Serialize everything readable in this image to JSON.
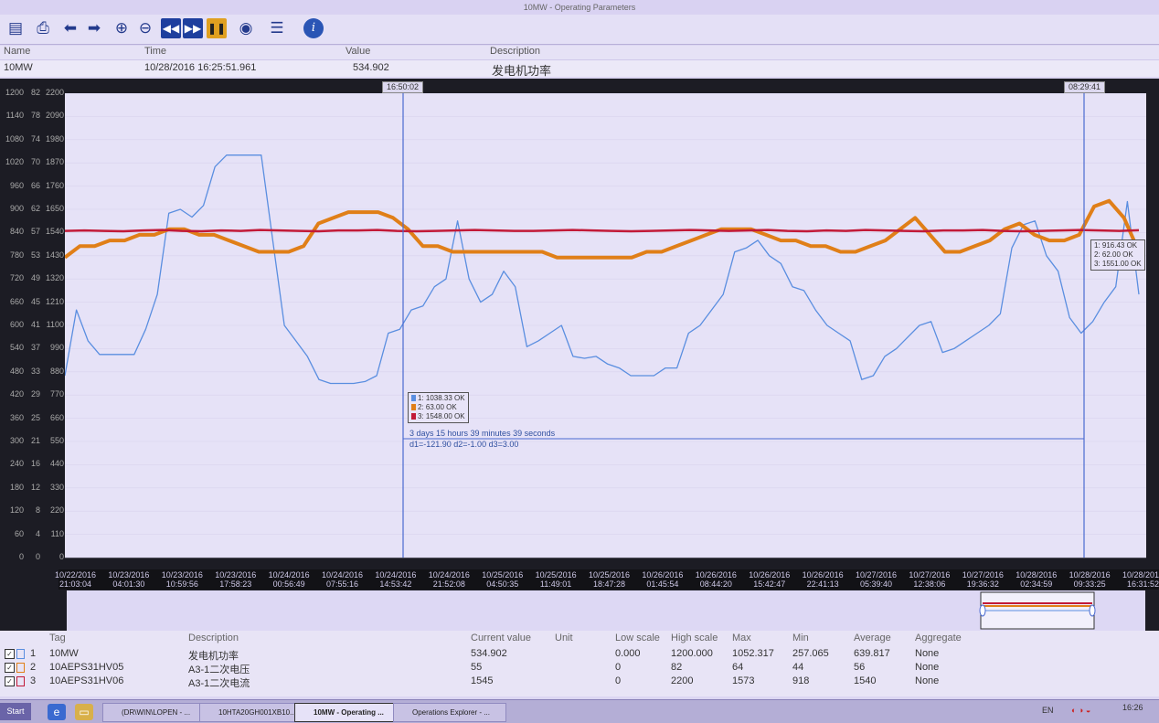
{
  "window": {
    "title": "10MW - Operating Parameters"
  },
  "toolbar": {
    "buttons": [
      {
        "name": "open-icon",
        "glyph": "▤"
      },
      {
        "name": "print-icon",
        "glyph": "⎙"
      },
      {
        "name": "back-arrow-icon",
        "glyph": "⬅"
      },
      {
        "name": "forward-arrow-icon",
        "glyph": "➡"
      },
      {
        "name": "zoom-in-icon",
        "glyph": "⊕"
      },
      {
        "name": "zoom-out-icon",
        "glyph": "⊖"
      },
      {
        "name": "rewind-icon",
        "glyph": "◀◀"
      },
      {
        "name": "fast-forward-icon",
        "glyph": "▶▶"
      },
      {
        "name": "pause-icon",
        "glyph": "❚❚"
      },
      {
        "name": "eye-icon",
        "glyph": "◉"
      },
      {
        "name": "list-settings-icon",
        "glyph": "☰"
      },
      {
        "name": "help-icon",
        "glyph": "i"
      }
    ]
  },
  "info": {
    "headers": {
      "name": "Name",
      "time": "Time",
      "value": "Value",
      "description": "Description"
    },
    "row": {
      "name": "10MW",
      "time": "10/28/2016 16:25:51.961",
      "value": "534.902",
      "description": "发电机功率"
    }
  },
  "chart_data": {
    "type": "line",
    "axes": [
      {
        "series": "10MW",
        "ylim": [
          0,
          1200
        ],
        "ticks": [
          "1200",
          "1140",
          "1080",
          "1020",
          "960",
          "900",
          "840",
          "780",
          "720",
          "660",
          "600",
          "540",
          "480",
          "420",
          "360",
          "300",
          "240",
          "180",
          "120",
          "60",
          "0"
        ]
      },
      {
        "series": "10AEPS31HV05",
        "ylim": [
          0,
          82
        ],
        "ticks": [
          "82",
          "78",
          "74",
          "70",
          "66",
          "62",
          "57",
          "53",
          "49",
          "45",
          "41",
          "37",
          "33",
          "29",
          "25",
          "21",
          "16",
          "12",
          "8",
          "4",
          "0"
        ]
      },
      {
        "series": "10AEPS31HV06",
        "ylim": [
          0,
          2200
        ],
        "ticks": [
          "2200",
          "2090",
          "1980",
          "1870",
          "1760",
          "1650",
          "1540",
          "1430",
          "1320",
          "1210",
          "1100",
          "990",
          "880",
          "770",
          "660",
          "550",
          "440",
          "330",
          "220",
          "110",
          "0"
        ]
      }
    ],
    "x_ticks": [
      [
        "10/22/2016",
        "21:03:04"
      ],
      [
        "10/23/2016",
        "04:01:30"
      ],
      [
        "10/23/2016",
        "10:59:56"
      ],
      [
        "10/23/2016",
        "17:58:23"
      ],
      [
        "10/24/2016",
        "00:56:49"
      ],
      [
        "10/24/2016",
        "07:55:16"
      ],
      [
        "10/24/2016",
        "14:53:42"
      ],
      [
        "10/24/2016",
        "21:52:08"
      ],
      [
        "10/25/2016",
        "04:50:35"
      ],
      [
        "10/25/2016",
        "11:49:01"
      ],
      [
        "10/25/2016",
        "18:47:28"
      ],
      [
        "10/26/2016",
        "01:45:54"
      ],
      [
        "10/26/2016",
        "08:44:20"
      ],
      [
        "10/26/2016",
        "15:42:47"
      ],
      [
        "10/26/2016",
        "22:41:13"
      ],
      [
        "10/27/2016",
        "05:39:40"
      ],
      [
        "10/27/2016",
        "12:38:06"
      ],
      [
        "10/27/2016",
        "19:36:32"
      ],
      [
        "10/28/2016",
        "02:34:59"
      ],
      [
        "10/28/2016",
        "09:33:25"
      ],
      [
        "10/28/2016",
        "16:31:52"
      ]
    ],
    "series": [
      {
        "name": "10MW",
        "color": "#5a8ee0",
        "axis": 0,
        "values": [
          470,
          640,
          560,
          525,
          525,
          525,
          525,
          590,
          680,
          890,
          900,
          880,
          910,
          1010,
          1040,
          1040,
          1040,
          1040,
          820,
          600,
          560,
          520,
          460,
          450,
          450,
          450,
          455,
          470,
          580,
          590,
          640,
          650,
          700,
          720,
          870,
          720,
          660,
          680,
          740,
          700,
          545,
          560,
          580,
          600,
          520,
          515,
          520,
          500,
          490,
          470,
          470,
          470,
          490,
          490,
          580,
          600,
          640,
          680,
          790,
          800,
          820,
          780,
          760,
          700,
          690,
          640,
          600,
          580,
          560,
          460,
          470,
          520,
          540,
          570,
          600,
          610,
          530,
          540,
          560,
          580,
          600,
          630,
          800,
          860,
          870,
          780,
          740,
          620,
          580,
          610,
          660,
          700,
          920,
          680
        ]
      },
      {
        "name": "10AEPS31HV05",
        "color": "#e07f18",
        "axis": 1,
        "values": [
          53,
          55,
          55,
          56,
          56,
          57,
          57,
          58,
          58,
          57,
          57,
          56,
          55,
          54,
          54,
          54,
          55,
          59,
          60,
          61,
          61,
          61,
          60,
          58,
          55,
          55,
          54,
          54,
          54,
          54,
          54,
          54,
          54,
          53,
          53,
          53,
          53,
          53,
          53,
          54,
          54,
          55,
          56,
          57,
          58,
          58,
          58,
          57,
          56,
          56,
          55,
          55,
          54,
          54,
          55,
          56,
          58,
          60,
          57,
          54,
          54,
          55,
          56,
          58,
          59,
          57,
          56,
          56,
          57,
          62,
          63,
          60,
          54
        ]
      },
      {
        "name": "10AEPS31HV06",
        "color": "#c21a38",
        "axis": 2,
        "values": [
          1548,
          1550,
          1548,
          1546,
          1550,
          1552,
          1548,
          1546,
          1550,
          1548,
          1552,
          1550,
          1548,
          1546,
          1550,
          1550,
          1552,
          1548,
          1546,
          1548,
          1550,
          1552,
          1550,
          1548,
          1548,
          1550,
          1552,
          1550,
          1548,
          1546,
          1548,
          1550,
          1552,
          1550,
          1548,
          1550,
          1552,
          1548,
          1546,
          1550,
          1548,
          1552,
          1550,
          1548,
          1546,
          1550,
          1550,
          1552,
          1548,
          1546,
          1548,
          1550,
          1552,
          1550,
          1548,
          1551
        ]
      }
    ],
    "cursors": [
      {
        "label": "16:50:02",
        "readouts": [
          {
            "series": "10MW",
            "text": "1: 1038.33 OK"
          },
          {
            "series": "10AEPS31HV05",
            "text": "2: 63.00 OK"
          },
          {
            "series": "10AEPS31HV06",
            "text": "3: 1548.00 OK"
          }
        ]
      },
      {
        "label": "08:29:41",
        "readouts": [
          {
            "series": "10MW",
            "text": "1: 916.43 OK"
          },
          {
            "series": "10AEPS31HV05",
            "text": "2: 62.00 OK"
          },
          {
            "series": "10AEPS31HV06",
            "text": "3: 1551.00 OK"
          }
        ]
      }
    ],
    "delta_text": "3 days 15 hours 39 minutes 39 seconds",
    "delta_values": "d1=-121.90  d2=-1.00  d3=3.00"
  },
  "legend": {
    "headers": {
      "tag": "Tag",
      "description": "Description",
      "current": "Current value",
      "unit": "Unit",
      "low": "Low scale",
      "high": "High scale",
      "max": "Max",
      "min": "Min",
      "avg": "Average",
      "agg": "Aggregate"
    },
    "rows": [
      {
        "idx": "1",
        "tag": "10MW",
        "description": "发电机功率",
        "current": "534.902",
        "unit": "",
        "low": "0.000",
        "high": "1200.000",
        "max": "1052.317",
        "min": "257.065",
        "avg": "639.817",
        "agg": "None",
        "color": "#5a8ee0"
      },
      {
        "idx": "2",
        "tag": "10AEPS31HV05",
        "description": "A3-1二次电压",
        "current": "55",
        "unit": "",
        "low": "0",
        "high": "82",
        "max": "64",
        "min": "44",
        "avg": "56",
        "agg": "None",
        "color": "#e07f18"
      },
      {
        "idx": "3",
        "tag": "10AEPS31HV06",
        "description": "A3-1二次电流",
        "current": "1545",
        "unit": "",
        "low": "0",
        "high": "2200",
        "max": "1573",
        "min": "918",
        "avg": "1540",
        "agg": "None",
        "color": "#c21a38"
      }
    ]
  },
  "taskbar": {
    "start": "Start",
    "tasks": [
      {
        "label": "(DR\\WIN\\LOPEN - ..."
      },
      {
        "label": "10HTA20GH001XB10..."
      },
      {
        "label": "10MW - Operating ..."
      },
      {
        "label": "Operations Explorer - ..."
      }
    ],
    "lang": "EN",
    "clock": "16:26"
  }
}
